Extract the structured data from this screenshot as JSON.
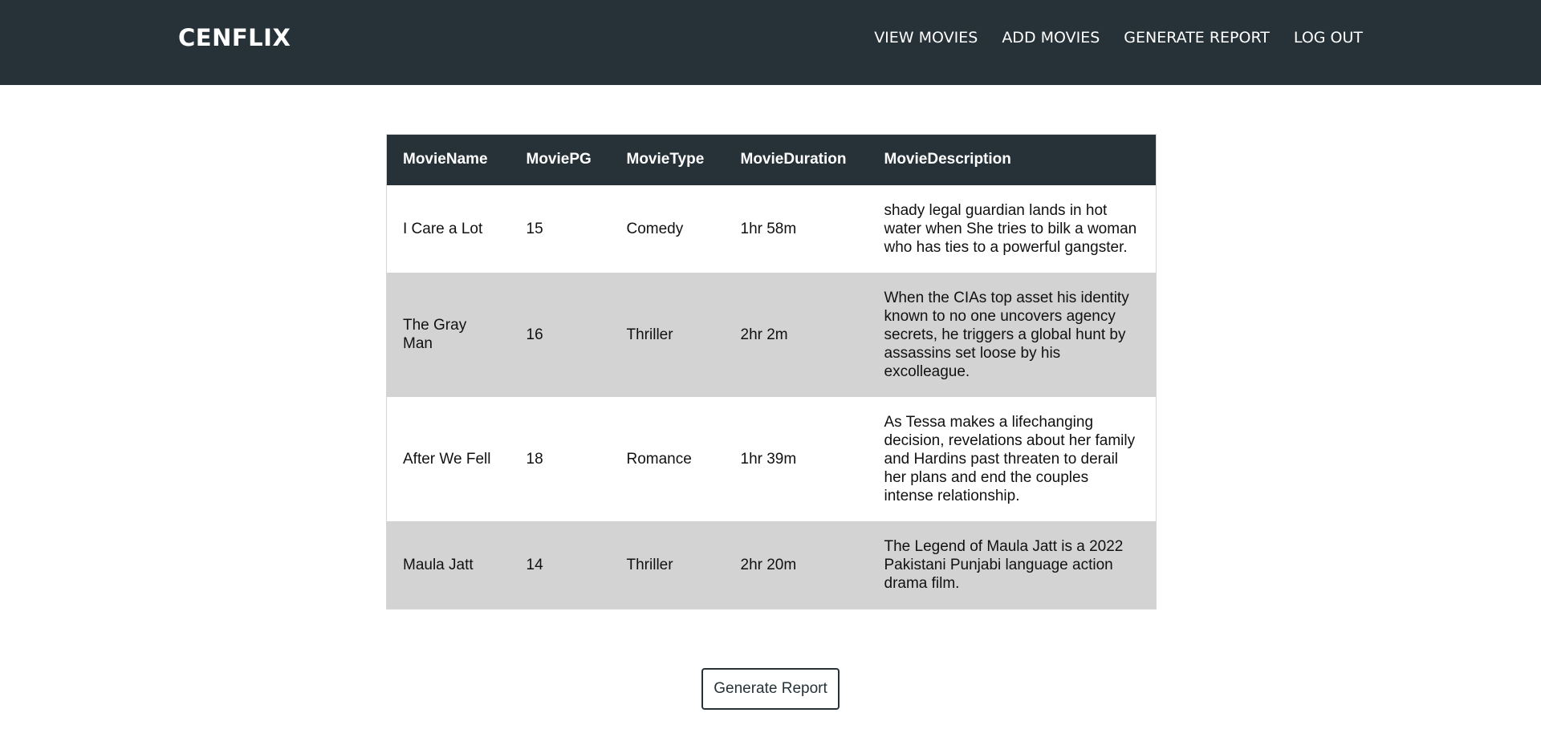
{
  "header": {
    "brand": "CENFLIX",
    "nav": [
      {
        "label": "VIEW MOVIES"
      },
      {
        "label": "ADD MOVIES"
      },
      {
        "label": "GENERATE REPORT"
      },
      {
        "label": "LOG OUT"
      }
    ]
  },
  "table": {
    "columns": [
      "MovieName",
      "MoviePG",
      "MovieType",
      "MovieDuration",
      "MovieDescription"
    ],
    "rows": [
      {
        "name": "I Care a Lot",
        "pg": "15",
        "type": "Comedy",
        "duration": "1hr 58m",
        "description": "shady legal guardian lands in hot water when She tries to bilk a woman who has ties to a powerful gangster."
      },
      {
        "name": "The Gray Man",
        "pg": "16",
        "type": "Thriller",
        "duration": "2hr 2m",
        "description": "When the CIAs top asset his identity known to no one uncovers agency secrets, he triggers a global hunt by assassins set loose by his excolleague."
      },
      {
        "name": "After We Fell",
        "pg": "18",
        "type": "Romance",
        "duration": "1hr 39m",
        "description": "As Tessa makes a lifechanging decision, revelations about her family and Hardins past threaten to derail her plans and end the couples intense relationship."
      },
      {
        "name": "Maula Jatt",
        "pg": "14",
        "type": "Thriller",
        "duration": "2hr 20m",
        "description": "The Legend of Maula Jatt is a 2022 Pakistani Punjabi language action drama film."
      }
    ]
  },
  "actions": {
    "generate_report_label": "Generate Report"
  },
  "colors": {
    "navbar_bg": "#263238",
    "row_alt_bg": "#d3d3d3",
    "text_light": "#ffffff"
  }
}
